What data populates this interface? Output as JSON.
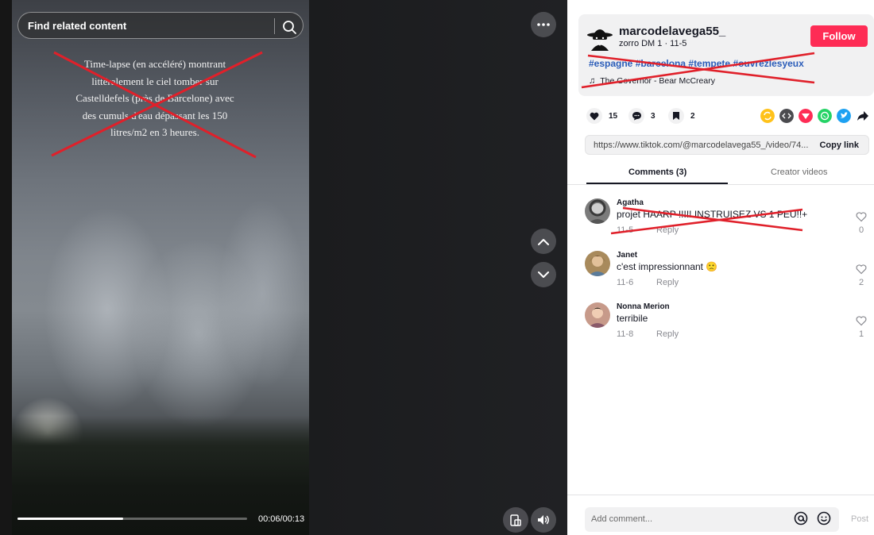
{
  "search": {
    "placeholder": "Find related content"
  },
  "video": {
    "overlay_text": "Time-lapse (en accéléré) montrant littéralement le ciel tomber sur Castelldefels (près de Barcelone) avec des cumuls d'eau dépassant les 150 litres/m2 en 3 heures.",
    "time": "00:06/00:13",
    "progress_fraction": 0.46
  },
  "post": {
    "username": "marcodelavega55_",
    "subline": "zorro DM 1 · 11-5",
    "follow_label": "Follow",
    "hashtags": "#espagne #barcelona #tempete #ouvrezlesyeux",
    "music": "The Governor - Bear McCreary"
  },
  "stats": {
    "likes": "15",
    "comments": "3",
    "saves": "2"
  },
  "link": {
    "url": "https://www.tiktok.com/@marcodelavega55_/video/74...",
    "copy_label": "Copy link"
  },
  "tabs": [
    {
      "label": "Comments (3)"
    },
    {
      "label": "Creator videos"
    }
  ],
  "comments": [
    {
      "name": "Agatha",
      "text": "projet HAARP !!!!! INSTRUISEZ VS 1 PEU!!+",
      "date": "11-5",
      "reply": "Reply",
      "likes": "0"
    },
    {
      "name": "Janet",
      "text": "c'est impressionnant 🙁",
      "date": "11-6",
      "reply": "Reply",
      "likes": "2"
    },
    {
      "name": "Nonna Merion",
      "text": "terribile",
      "date": "11-8",
      "reply": "Reply",
      "likes": "1"
    }
  ],
  "composer": {
    "placeholder": "Add comment...",
    "post_label": "Post"
  },
  "colors": {
    "accent": "#fe2c55",
    "hashtag": "#2b5db9",
    "strike": "#e0202a"
  }
}
